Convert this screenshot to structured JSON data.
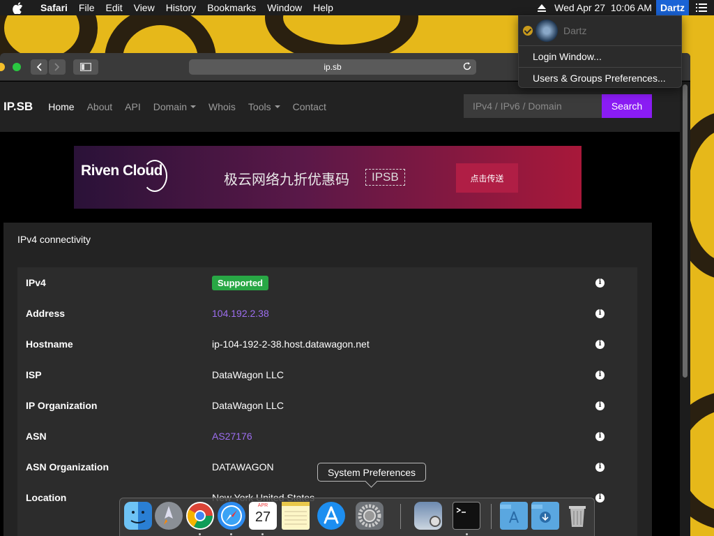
{
  "menubar": {
    "app": "Safari",
    "menus": [
      "File",
      "Edit",
      "View",
      "History",
      "Bookmarks",
      "Window",
      "Help"
    ],
    "clock": "Wed Apr 27  10:06 AM",
    "user": "Dartz"
  },
  "user_menu": {
    "current_user": "Dartz",
    "items": [
      "Login Window...",
      "Users & Groups Preferences..."
    ]
  },
  "browser": {
    "url": "ip.sb"
  },
  "site": {
    "brand": "IP.SB",
    "nav": [
      {
        "label": "Home",
        "active": true,
        "dropdown": false
      },
      {
        "label": "About",
        "active": false,
        "dropdown": false
      },
      {
        "label": "API",
        "active": false,
        "dropdown": false
      },
      {
        "label": "Domain",
        "active": false,
        "dropdown": true
      },
      {
        "label": "Whois",
        "active": false,
        "dropdown": false
      },
      {
        "label": "Tools",
        "active": false,
        "dropdown": true
      },
      {
        "label": "Contact",
        "active": false,
        "dropdown": false
      }
    ],
    "search_placeholder": "IPv4 / IPv6 / Domain",
    "search_button": "Search"
  },
  "banner": {
    "logo": "Riven Cloud",
    "promo": "极云网络九折优惠码",
    "code": "IPSB",
    "cta": "点击传送"
  },
  "card": {
    "title": "IPv4 connectivity",
    "rows": [
      {
        "key": "IPv4",
        "value": "Supported",
        "style": "badge"
      },
      {
        "key": "Address",
        "value": "104.192.2.38",
        "style": "link"
      },
      {
        "key": "Hostname",
        "value": "ip-104-192-2-38.host.datawagon.net",
        "style": "text"
      },
      {
        "key": "ISP",
        "value": "DataWagon LLC",
        "style": "text"
      },
      {
        "key": "IP Organization",
        "value": "DataWagon LLC",
        "style": "text"
      },
      {
        "key": "ASN",
        "value": "AS27176",
        "style": "link"
      },
      {
        "key": "ASN Organization",
        "value": "DATAWAGON",
        "style": "text"
      },
      {
        "key": "Location",
        "value": "New York United States",
        "style": "text"
      }
    ]
  },
  "tooltip": "System Preferences",
  "dock": {
    "apps": [
      "finder",
      "launchpad",
      "chrome",
      "safari",
      "calendar",
      "notes",
      "app-store",
      "system-preferences",
      "preview",
      "terminal",
      "applications-folder",
      "downloads-folder",
      "trash"
    ],
    "calendar_month": "APR",
    "calendar_day": "27"
  },
  "colors": {
    "accent_purple": "#8a1cf3",
    "link_purple": "#9d6ef0",
    "success_green": "#28a745",
    "menubar_user_blue": "#1a63d6"
  }
}
